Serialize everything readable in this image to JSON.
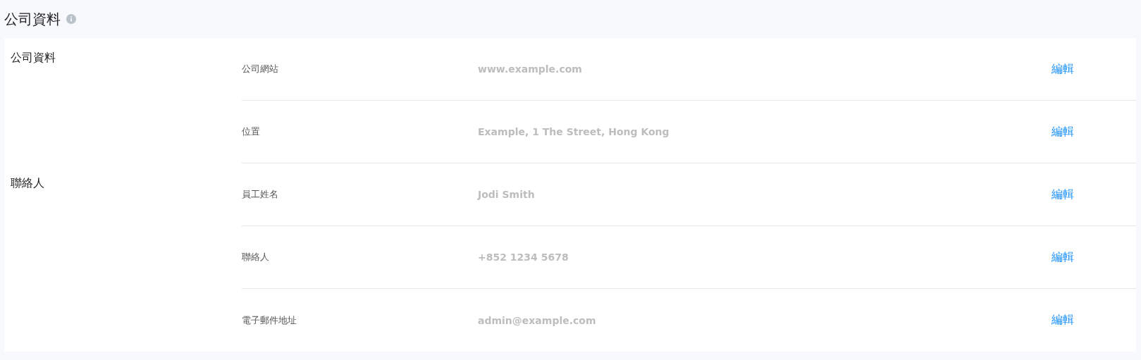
{
  "page_title": "公司資料",
  "sections": [
    {
      "title": "公司資料",
      "fields": [
        {
          "label": "公司網站",
          "value": "www.example.com",
          "action": "編輯"
        },
        {
          "label": "位置",
          "value": "Example, 1 The Street, Hong Kong",
          "action": "編輯"
        }
      ]
    },
    {
      "title": "聯絡人",
      "fields": [
        {
          "label": "員工姓名",
          "value": "Jodi Smith",
          "action": "編輯"
        },
        {
          "label": "聯絡人",
          "value": "+852 1234 5678",
          "action": "編輯"
        },
        {
          "label": "電子郵件地址",
          "value": "admin@example.com",
          "action": "編輯"
        }
      ]
    }
  ]
}
